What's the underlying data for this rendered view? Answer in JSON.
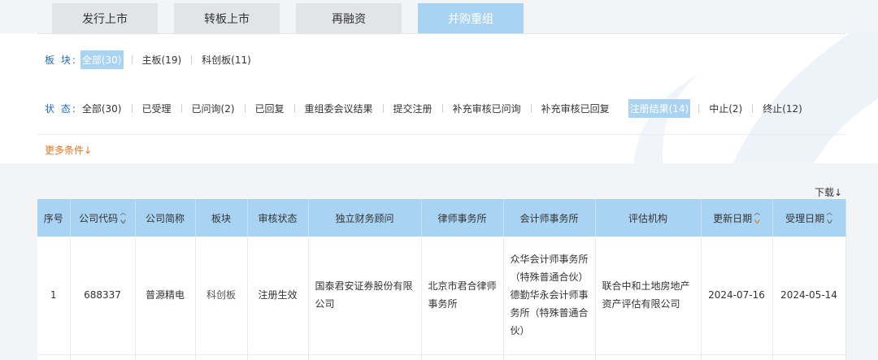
{
  "tabs": [
    {
      "label": "发行上市"
    },
    {
      "label": "转板上市"
    },
    {
      "label": "再融资"
    },
    {
      "label": "并购重组"
    }
  ],
  "filters": {
    "board_label": "板  块:",
    "board_options": [
      {
        "label": "全部(30)"
      },
      {
        "label": "主板(19)"
      },
      {
        "label": "科创板(11)"
      }
    ],
    "status_label": "状  态:",
    "status_options": [
      {
        "label": "全部(30)"
      },
      {
        "label": "已受理"
      },
      {
        "label": "已问询(2)"
      },
      {
        "label": "已回复"
      },
      {
        "label": "重组委会议结果"
      },
      {
        "label": "提交注册"
      },
      {
        "label": "补充审核已问询"
      },
      {
        "label": "补充审核已回复"
      },
      {
        "label": "注册结果(14)"
      },
      {
        "label": "中止(2)"
      },
      {
        "label": "终止(12)"
      }
    ],
    "more_label": "更多条件↓"
  },
  "download_label": "下载↓",
  "table": {
    "headers": [
      "序号",
      "公司代码",
      "公司简称",
      "板块",
      "审核状态",
      "独立财务顾问",
      "律师事务所",
      "会计师事务所",
      "评估机构",
      "更新日期",
      "受理日期"
    ],
    "rows": [
      {
        "no": "1",
        "code": "688337",
        "name": "普源精电",
        "board": "科创板",
        "status": "注册生效",
        "advisor": "国泰君安证券股份有限公司",
        "law_firm": "北京市君合律师事务所",
        "accounting": "众华会计师事务所（特殊普通合伙）德勤华永会计师事务所（特殊普通合伙）",
        "appraisal": "联合中和土地房地产资产评估有限公司",
        "updated": "2024-07-16",
        "accepted": "2024-05-14"
      }
    ]
  }
}
